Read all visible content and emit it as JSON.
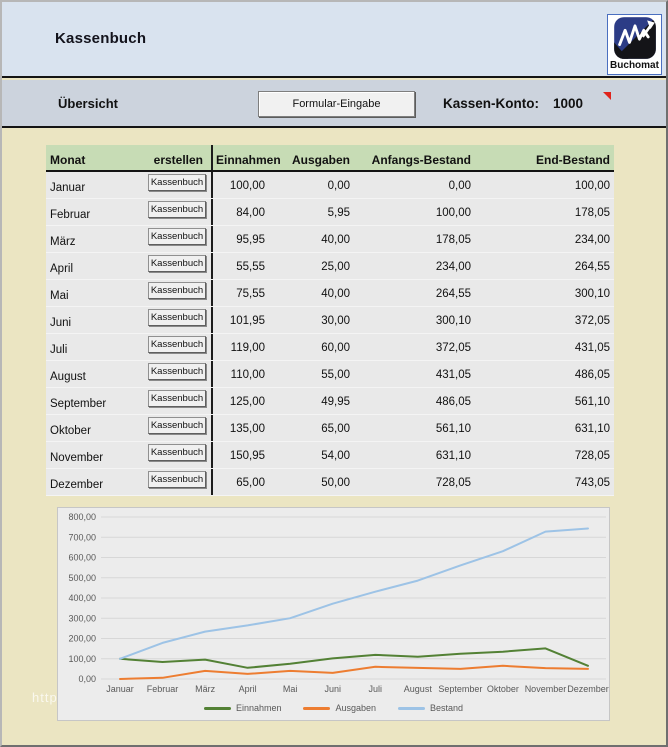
{
  "header": {
    "title": "Kassenbuch",
    "logo_text": "Buchomat"
  },
  "toolbar": {
    "section_label": "Übersicht",
    "form_button_label": "Formular-Eingabe",
    "account_label": "Kassen-Konto:",
    "account_value": "1000"
  },
  "table": {
    "headers": [
      "Monat",
      "erstellen",
      "Einnahmen",
      "Ausgaben",
      "Anfangs-Bestand",
      "End-Bestand"
    ],
    "row_button_label": "Kassenbuch",
    "rows": [
      {
        "monat": "Januar",
        "einnahmen": "100,00",
        "ausgaben": "0,00",
        "anfangs_bestand": "0,00",
        "end_bestand": "100,00"
      },
      {
        "monat": "Februar",
        "einnahmen": "84,00",
        "ausgaben": "5,95",
        "anfangs_bestand": "100,00",
        "end_bestand": "178,05"
      },
      {
        "monat": "März",
        "einnahmen": "95,95",
        "ausgaben": "40,00",
        "anfangs_bestand": "178,05",
        "end_bestand": "234,00"
      },
      {
        "monat": "April",
        "einnahmen": "55,55",
        "ausgaben": "25,00",
        "anfangs_bestand": "234,00",
        "end_bestand": "264,55"
      },
      {
        "monat": "Mai",
        "einnahmen": "75,55",
        "ausgaben": "40,00",
        "anfangs_bestand": "264,55",
        "end_bestand": "300,10"
      },
      {
        "monat": "Juni",
        "einnahmen": "101,95",
        "ausgaben": "30,00",
        "anfangs_bestand": "300,10",
        "end_bestand": "372,05"
      },
      {
        "monat": "Juli",
        "einnahmen": "119,00",
        "ausgaben": "60,00",
        "anfangs_bestand": "372,05",
        "end_bestand": "431,05"
      },
      {
        "monat": "August",
        "einnahmen": "110,00",
        "ausgaben": "55,00",
        "anfangs_bestand": "431,05",
        "end_bestand": "486,05"
      },
      {
        "monat": "September",
        "einnahmen": "125,00",
        "ausgaben": "49,95",
        "anfangs_bestand": "486,05",
        "end_bestand": "561,10"
      },
      {
        "monat": "Oktober",
        "einnahmen": "135,00",
        "ausgaben": "65,00",
        "anfangs_bestand": "561,10",
        "end_bestand": "631,10"
      },
      {
        "monat": "November",
        "einnahmen": "150,95",
        "ausgaben": "54,00",
        "anfangs_bestand": "631,10",
        "end_bestand": "728,05"
      },
      {
        "monat": "Dezember",
        "einnahmen": "65,00",
        "ausgaben": "50,00",
        "anfangs_bestand": "728,05",
        "end_bestand": "743,05"
      }
    ]
  },
  "chart_data": {
    "type": "line",
    "categories": [
      "Januar",
      "Februar",
      "März",
      "April",
      "Mai",
      "Juni",
      "Juli",
      "August",
      "September",
      "Oktober",
      "November",
      "Dezember"
    ],
    "series": [
      {
        "name": "Einnahmen",
        "color": "#538135",
        "values": [
          100.0,
          84.0,
          95.95,
          55.55,
          75.55,
          101.95,
          119.0,
          110.0,
          125.0,
          135.0,
          150.95,
          65.0
        ]
      },
      {
        "name": "Ausgaben",
        "color": "#ed7d31",
        "values": [
          0.0,
          5.95,
          40.0,
          25.0,
          40.0,
          30.0,
          60.0,
          55.0,
          49.95,
          65.0,
          54.0,
          50.0
        ]
      },
      {
        "name": "Bestand",
        "color": "#9dc3e6",
        "values": [
          100.0,
          178.05,
          234.0,
          264.55,
          300.1,
          372.05,
          431.05,
          486.05,
          561.1,
          631.1,
          728.05,
          743.05
        ]
      }
    ],
    "title": "",
    "xlabel": "",
    "ylabel": "",
    "ylim": [
      0,
      800
    ],
    "ytick_step": 100,
    "ytick_labels": [
      "0,00",
      "100,00",
      "200,00",
      "300,00",
      "400,00",
      "500,00",
      "600,00",
      "700,00",
      "800,00"
    ],
    "grid": true,
    "legend_position": "bottom"
  },
  "watermark": {
    "text": "http"
  },
  "colors": {
    "header_band": "#d9e3ef",
    "toolbar_band": "#ccd3dd",
    "page_background": "#ebe5c2",
    "table_header_green": "#c7dcb5",
    "row_gray": "#e9e9e9",
    "comment_flag_red": "#e0231b",
    "series_einnahmen": "#538135",
    "series_ausgaben": "#ed7d31",
    "series_bestand": "#9dc3e6"
  }
}
